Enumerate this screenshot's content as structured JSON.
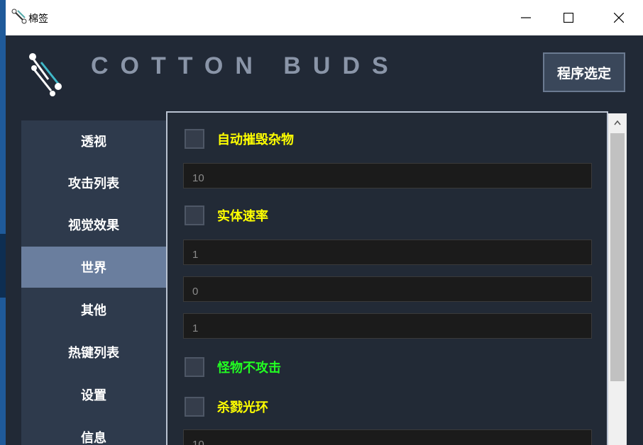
{
  "window": {
    "title": "棉签"
  },
  "header": {
    "title": "COTTON BUDS",
    "select_button": "程序选定"
  },
  "sidebar": {
    "items": [
      {
        "label": "透视",
        "active": false
      },
      {
        "label": "攻击列表",
        "active": false
      },
      {
        "label": "视觉效果",
        "active": false
      },
      {
        "label": "世界",
        "active": true
      },
      {
        "label": "其他",
        "active": false
      },
      {
        "label": "热键列表",
        "active": false
      },
      {
        "label": "设置",
        "active": false
      },
      {
        "label": "信息",
        "active": false
      }
    ]
  },
  "content": {
    "auto_destroy": {
      "label": "自动摧毁杂物",
      "color": "#ffff00",
      "value": "10"
    },
    "entity_speed": {
      "label": "实体速率",
      "color": "#ffff00",
      "values": [
        "1",
        "0",
        "1"
      ]
    },
    "mob_no_attack": {
      "label": "怪物不攻击",
      "color": "#22ff22"
    },
    "kill_aura": {
      "label": "杀戮光环",
      "color": "#ffff00",
      "value": "10"
    }
  },
  "colors": {
    "background": "#212936",
    "sidebar": "#2e3a4c",
    "active_item": "#6a7e9e",
    "accent": "#8a95a8"
  }
}
